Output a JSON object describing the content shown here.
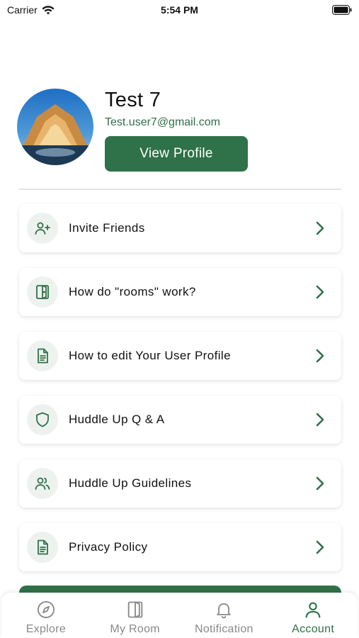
{
  "status_bar": {
    "carrier": "Carrier",
    "time": "5:54 PM"
  },
  "profile": {
    "name": "Test 7",
    "email": "Test.user7@gmail.com",
    "view_profile_label": "View Profile"
  },
  "menu": {
    "items": [
      {
        "label": "Invite Friends",
        "icon": "add-user-icon"
      },
      {
        "label": "How do \"rooms\" work?",
        "icon": "door-icon"
      },
      {
        "label": "How to edit Your User Profile",
        "icon": "document-icon"
      },
      {
        "label": "Huddle Up Q & A",
        "icon": "shield-icon"
      },
      {
        "label": "Huddle Up Guidelines",
        "icon": "users-icon"
      },
      {
        "label": "Privacy Policy",
        "icon": "document-icon"
      }
    ]
  },
  "tabbar": {
    "tabs": [
      {
        "label": "Explore",
        "icon": "compass-icon",
        "active": false
      },
      {
        "label": "My Room",
        "icon": "door-icon",
        "active": false
      },
      {
        "label": "Notification",
        "icon": "bell-icon",
        "active": false
      },
      {
        "label": "Account",
        "icon": "user-icon",
        "active": true
      }
    ]
  },
  "colors": {
    "accent": "#2f7148",
    "icon_bg": "#eef2ef",
    "inactive": "#8a8a8a"
  }
}
